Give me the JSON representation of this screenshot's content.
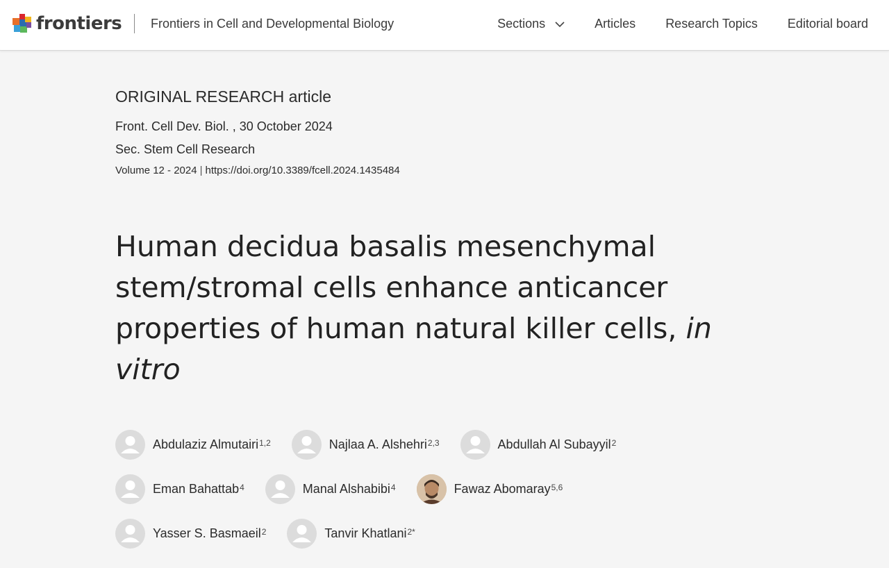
{
  "header": {
    "logo_text": "frontiers",
    "journal_name": "Frontiers in Cell and Developmental Biology",
    "nav": [
      {
        "label": "Sections"
      },
      {
        "label": "Articles"
      },
      {
        "label": "Research Topics"
      },
      {
        "label": "Editorial board"
      }
    ]
  },
  "article": {
    "type": "ORIGINAL RESEARCH article",
    "citation": "Front. Cell Dev. Biol. , 30 October 2024",
    "section": "Sec. Stem Cell Research",
    "volume": "Volume 12 - 2024",
    "separator": "|",
    "doi": "https://doi.org/10.3389/fcell.2024.1435484",
    "title_main": "Human decidua basalis mesenchymal stem/stromal cells enhance anticancer properties of human natural killer cells, ",
    "title_italic": "in vitro"
  },
  "authors": [
    {
      "name": "Abdulaziz Almutairi",
      "affil": "1,2",
      "avatar": "user-placeholder-icon"
    },
    {
      "name": "Najlaa A. Alshehri",
      "affil": "2,3",
      "avatar": "user-placeholder-icon"
    },
    {
      "name": "Abdullah Al Subayyil",
      "affil": "2",
      "avatar": "user-placeholder-icon"
    },
    {
      "name": "Eman Bahattab",
      "affil": "4",
      "avatar": "user-placeholder-icon"
    },
    {
      "name": "Manal Alshabibi",
      "affil": "4",
      "avatar": "user-placeholder-icon"
    },
    {
      "name": "Fawaz Abomaray",
      "affil": "5,6",
      "avatar": "author-photo"
    },
    {
      "name": "Yasser S. Basmaeil",
      "affil": "2",
      "avatar": "user-placeholder-icon"
    },
    {
      "name": "Tanvir Khatlani",
      "affil": "2*",
      "avatar": "user-placeholder-icon"
    }
  ],
  "colors": {
    "page_background": "#f5f5f5",
    "header_background": "#ffffff",
    "avatar_placeholder": "#dcdcdc",
    "text": "#2b2b2b"
  }
}
